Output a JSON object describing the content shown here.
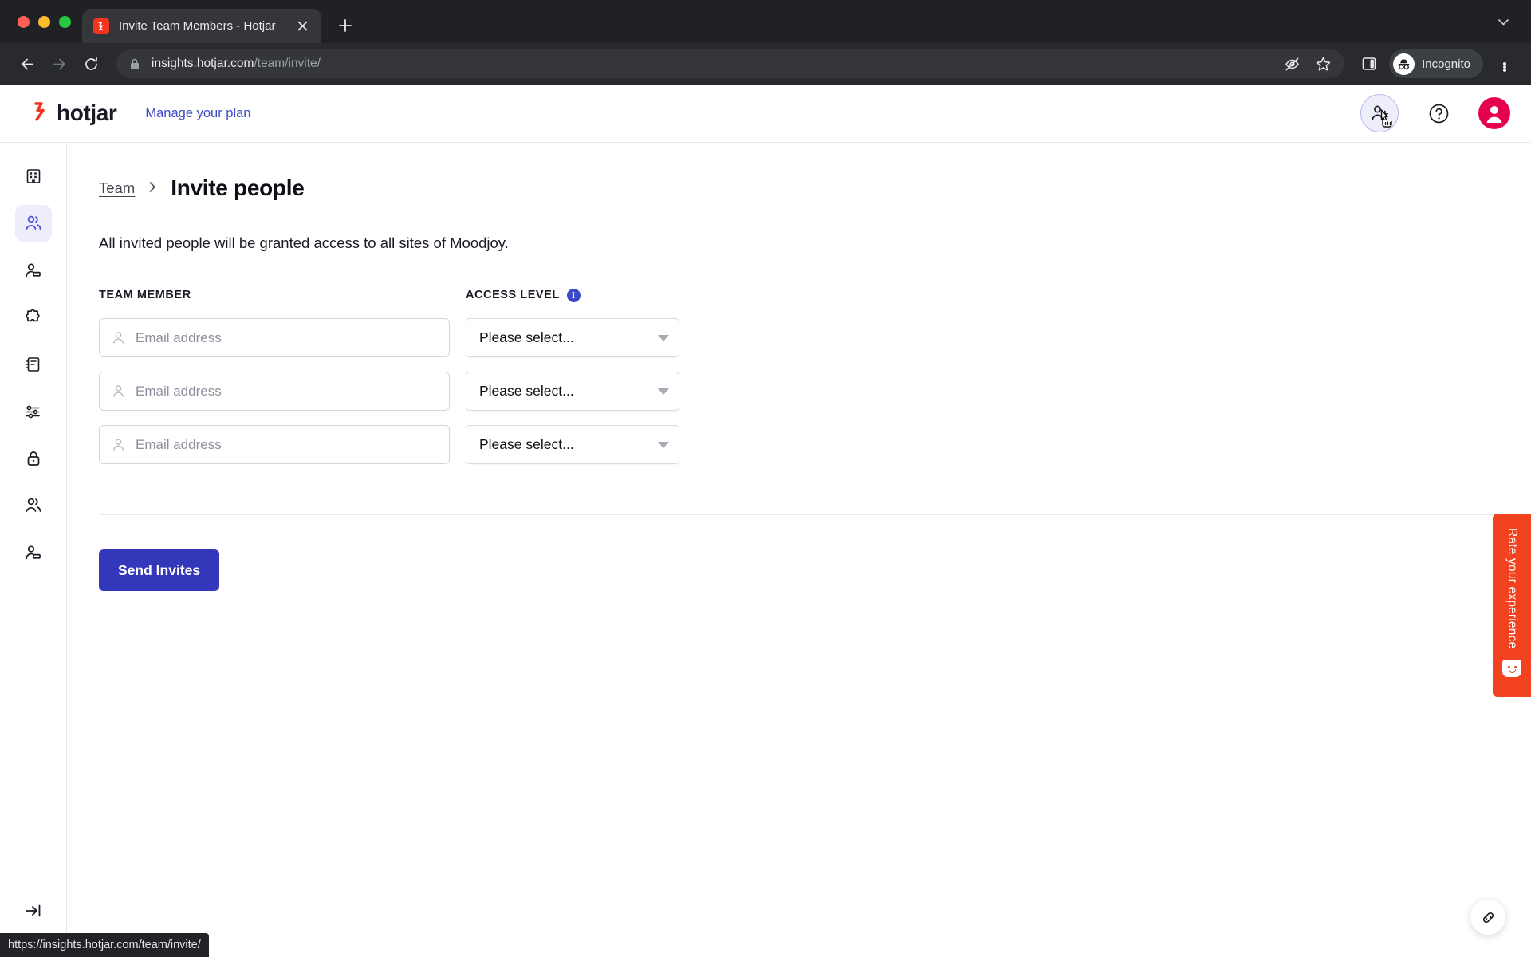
{
  "browser": {
    "tab": {
      "title": "Invite Team Members - Hotjar",
      "favicon_icon": "hotjar-favicon",
      "close_icon": "close-icon"
    },
    "new_tab_icon": "plus-icon",
    "tabstrip_menu_icon": "chevron-down-icon",
    "back_icon": "back-arrow-icon",
    "forward_icon": "forward-arrow-icon",
    "reload_icon": "reload-icon",
    "lock_icon": "lock-icon",
    "url_domain": "insights.hotjar.com",
    "url_path": "/team/invite/",
    "tracking_protection_icon": "eye-slash-icon",
    "bookmark_icon": "star-icon",
    "side_panel_icon": "side-panel-icon",
    "incognito_label": "Incognito",
    "incognito_icon": "incognito-hat-icon",
    "menu_icon": "kebab-menu-icon",
    "status_url": "https://insights.hotjar.com/team/invite/"
  },
  "app": {
    "logo_text": "hotjar",
    "logo_icon": "hotjar-logo-icon",
    "manage_plan_label": "Manage your plan",
    "header_icons": {
      "invite_people_icon": "add-person-icon",
      "help_icon": "question-mark-icon",
      "account_icon": "user-avatar-icon"
    },
    "accent_color": "#3338bb",
    "brand_color": "#f5341f",
    "avatar_color": "#e60050"
  },
  "sidebar": {
    "items": [
      {
        "icon": "organization-building-icon",
        "name": "sidebar-item-organization",
        "active": false
      },
      {
        "icon": "team-people-icon",
        "name": "sidebar-item-team",
        "active": true
      },
      {
        "icon": "person-card-icon",
        "name": "sidebar-item-invites",
        "active": false
      },
      {
        "icon": "puzzle-piece-icon",
        "name": "sidebar-item-integrations",
        "active": false
      },
      {
        "icon": "notebook-icon",
        "name": "sidebar-item-sites",
        "active": false
      },
      {
        "icon": "sliders-icon",
        "name": "sidebar-item-settings",
        "active": false
      },
      {
        "icon": "lock-icon",
        "name": "sidebar-item-privacy",
        "active": false
      },
      {
        "icon": "team-people-icon",
        "name": "sidebar-item-groups",
        "active": false
      },
      {
        "icon": "person-card-icon",
        "name": "sidebar-item-members",
        "active": false
      }
    ],
    "collapse_icon": "collapse-sidebar-icon"
  },
  "main": {
    "breadcrumb": {
      "parent_label": "Team",
      "separator": "›",
      "current_label": "Invite people"
    },
    "intro_text": "All invited people will be granted access to all sites of Moodjoy.",
    "columns": {
      "team_member_label": "TEAM MEMBER",
      "access_level_label": "ACCESS LEVEL",
      "access_level_info_icon": "info-icon",
      "info_glyph": "i"
    },
    "rows": [
      {
        "email_value": "",
        "email_placeholder": "Email address",
        "access_value": "Please select..."
      },
      {
        "email_value": "",
        "email_placeholder": "Email address",
        "access_value": "Please select..."
      },
      {
        "email_value": "",
        "email_placeholder": "Email address",
        "access_value": "Please select..."
      }
    ],
    "email_field_icon": "person-outline-icon",
    "select_caret_icon": "caret-down-icon",
    "send_button_label": "Send Invites"
  },
  "feedback_widget": {
    "label": "Rate your experience",
    "icon": "smiley-face-icon",
    "color": "#f3421f"
  },
  "fab": {
    "icon": "link-chain-icon"
  }
}
